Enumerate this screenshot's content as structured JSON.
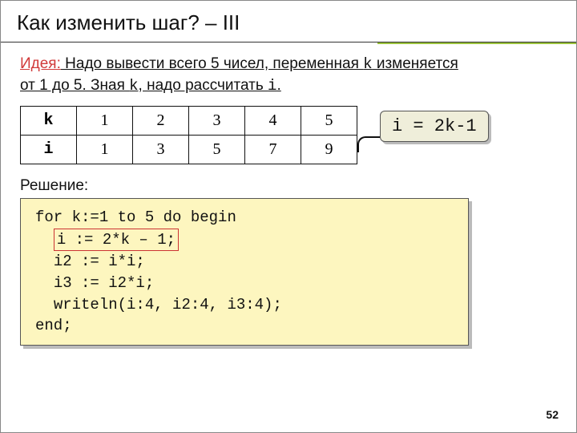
{
  "title": "Как изменить шаг? – III",
  "idea": {
    "label": "Идея:",
    "line1a": " Надо вывести всего 5 чисел, переменная ",
    "var1": "k",
    "line1b": " изменяется ",
    "line2a": "от 1 до 5. Зная ",
    "var2": "k",
    "line2b": ", надо рассчитать ",
    "var3": "i",
    "line2c": "."
  },
  "table": {
    "rowHeads": [
      "k",
      "i"
    ],
    "row1": [
      "1",
      "2",
      "3",
      "4",
      "5"
    ],
    "row2": [
      "1",
      "3",
      "5",
      "7",
      "9"
    ]
  },
  "formula": "i = 2k-1",
  "solutionLabel": "Решение:",
  "code": {
    "l1": "for k:=1 to 5 do begin",
    "l2": "i := 2*k – 1;",
    "l3": "i2 := i*i;",
    "l4": "i3 := i2*i;",
    "l5": "writeln(i:4, i2:4, i3:4);",
    "l6": "end;"
  },
  "pageNumber": "52"
}
